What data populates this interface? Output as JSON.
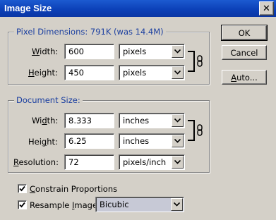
{
  "window": {
    "title": "Image Size",
    "close_glyph": "✕"
  },
  "pixel_dimensions": {
    "legend": "Pixel Dimensions:  791K (was 14.4M)",
    "width": {
      "label_pre": "",
      "label_ul": "W",
      "label_post": "idth:",
      "value": "600",
      "unit": "pixels"
    },
    "height": {
      "label_pre": "",
      "label_ul": "H",
      "label_post": "eight:",
      "value": "450",
      "unit": "pixels"
    }
  },
  "document_size": {
    "legend": "Document Size:",
    "width": {
      "label_pre": "Wi",
      "label_ul": "d",
      "label_post": "th:",
      "value": "8.333",
      "unit": "inches"
    },
    "height": {
      "label_pre": "Hei",
      "label_ul": "g",
      "label_post": "ht:",
      "value": "6.25",
      "unit": "inches"
    },
    "resolution": {
      "label_pre": "",
      "label_ul": "R",
      "label_post": "esolution:",
      "value": "72",
      "unit": "pixels/inch"
    }
  },
  "options": {
    "constrain": {
      "label_ul": "C",
      "label_post": "onstrain Proportions",
      "checked": true
    },
    "resample": {
      "label_pre": "Resample ",
      "label_ul": "I",
      "label_post": "mage:",
      "checked": true,
      "method": "Bicubic"
    }
  },
  "buttons": {
    "ok": "OK",
    "cancel": "Cancel",
    "auto": {
      "label_ul": "A",
      "label_post": "uto..."
    }
  },
  "icons": {
    "chain": "chain-link-icon",
    "dropdown": "chevron-down-icon",
    "check": "checkmark-icon"
  }
}
